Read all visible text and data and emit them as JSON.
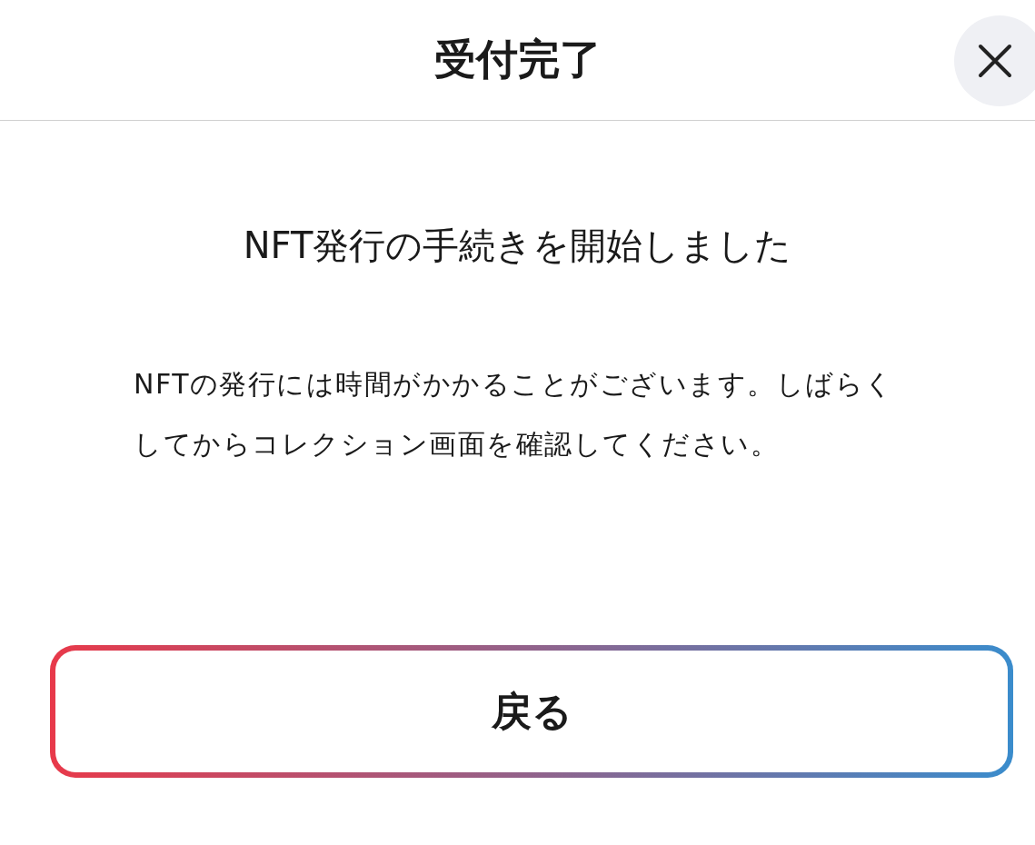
{
  "header": {
    "title": "受付完了"
  },
  "message": {
    "heading": "NFT発行の手続きを開始しました",
    "body": "NFTの発行には時間がかかることがございます。しばらくしてからコレクション画面を確認してください。"
  },
  "buttons": [
    "戻る"
  ]
}
